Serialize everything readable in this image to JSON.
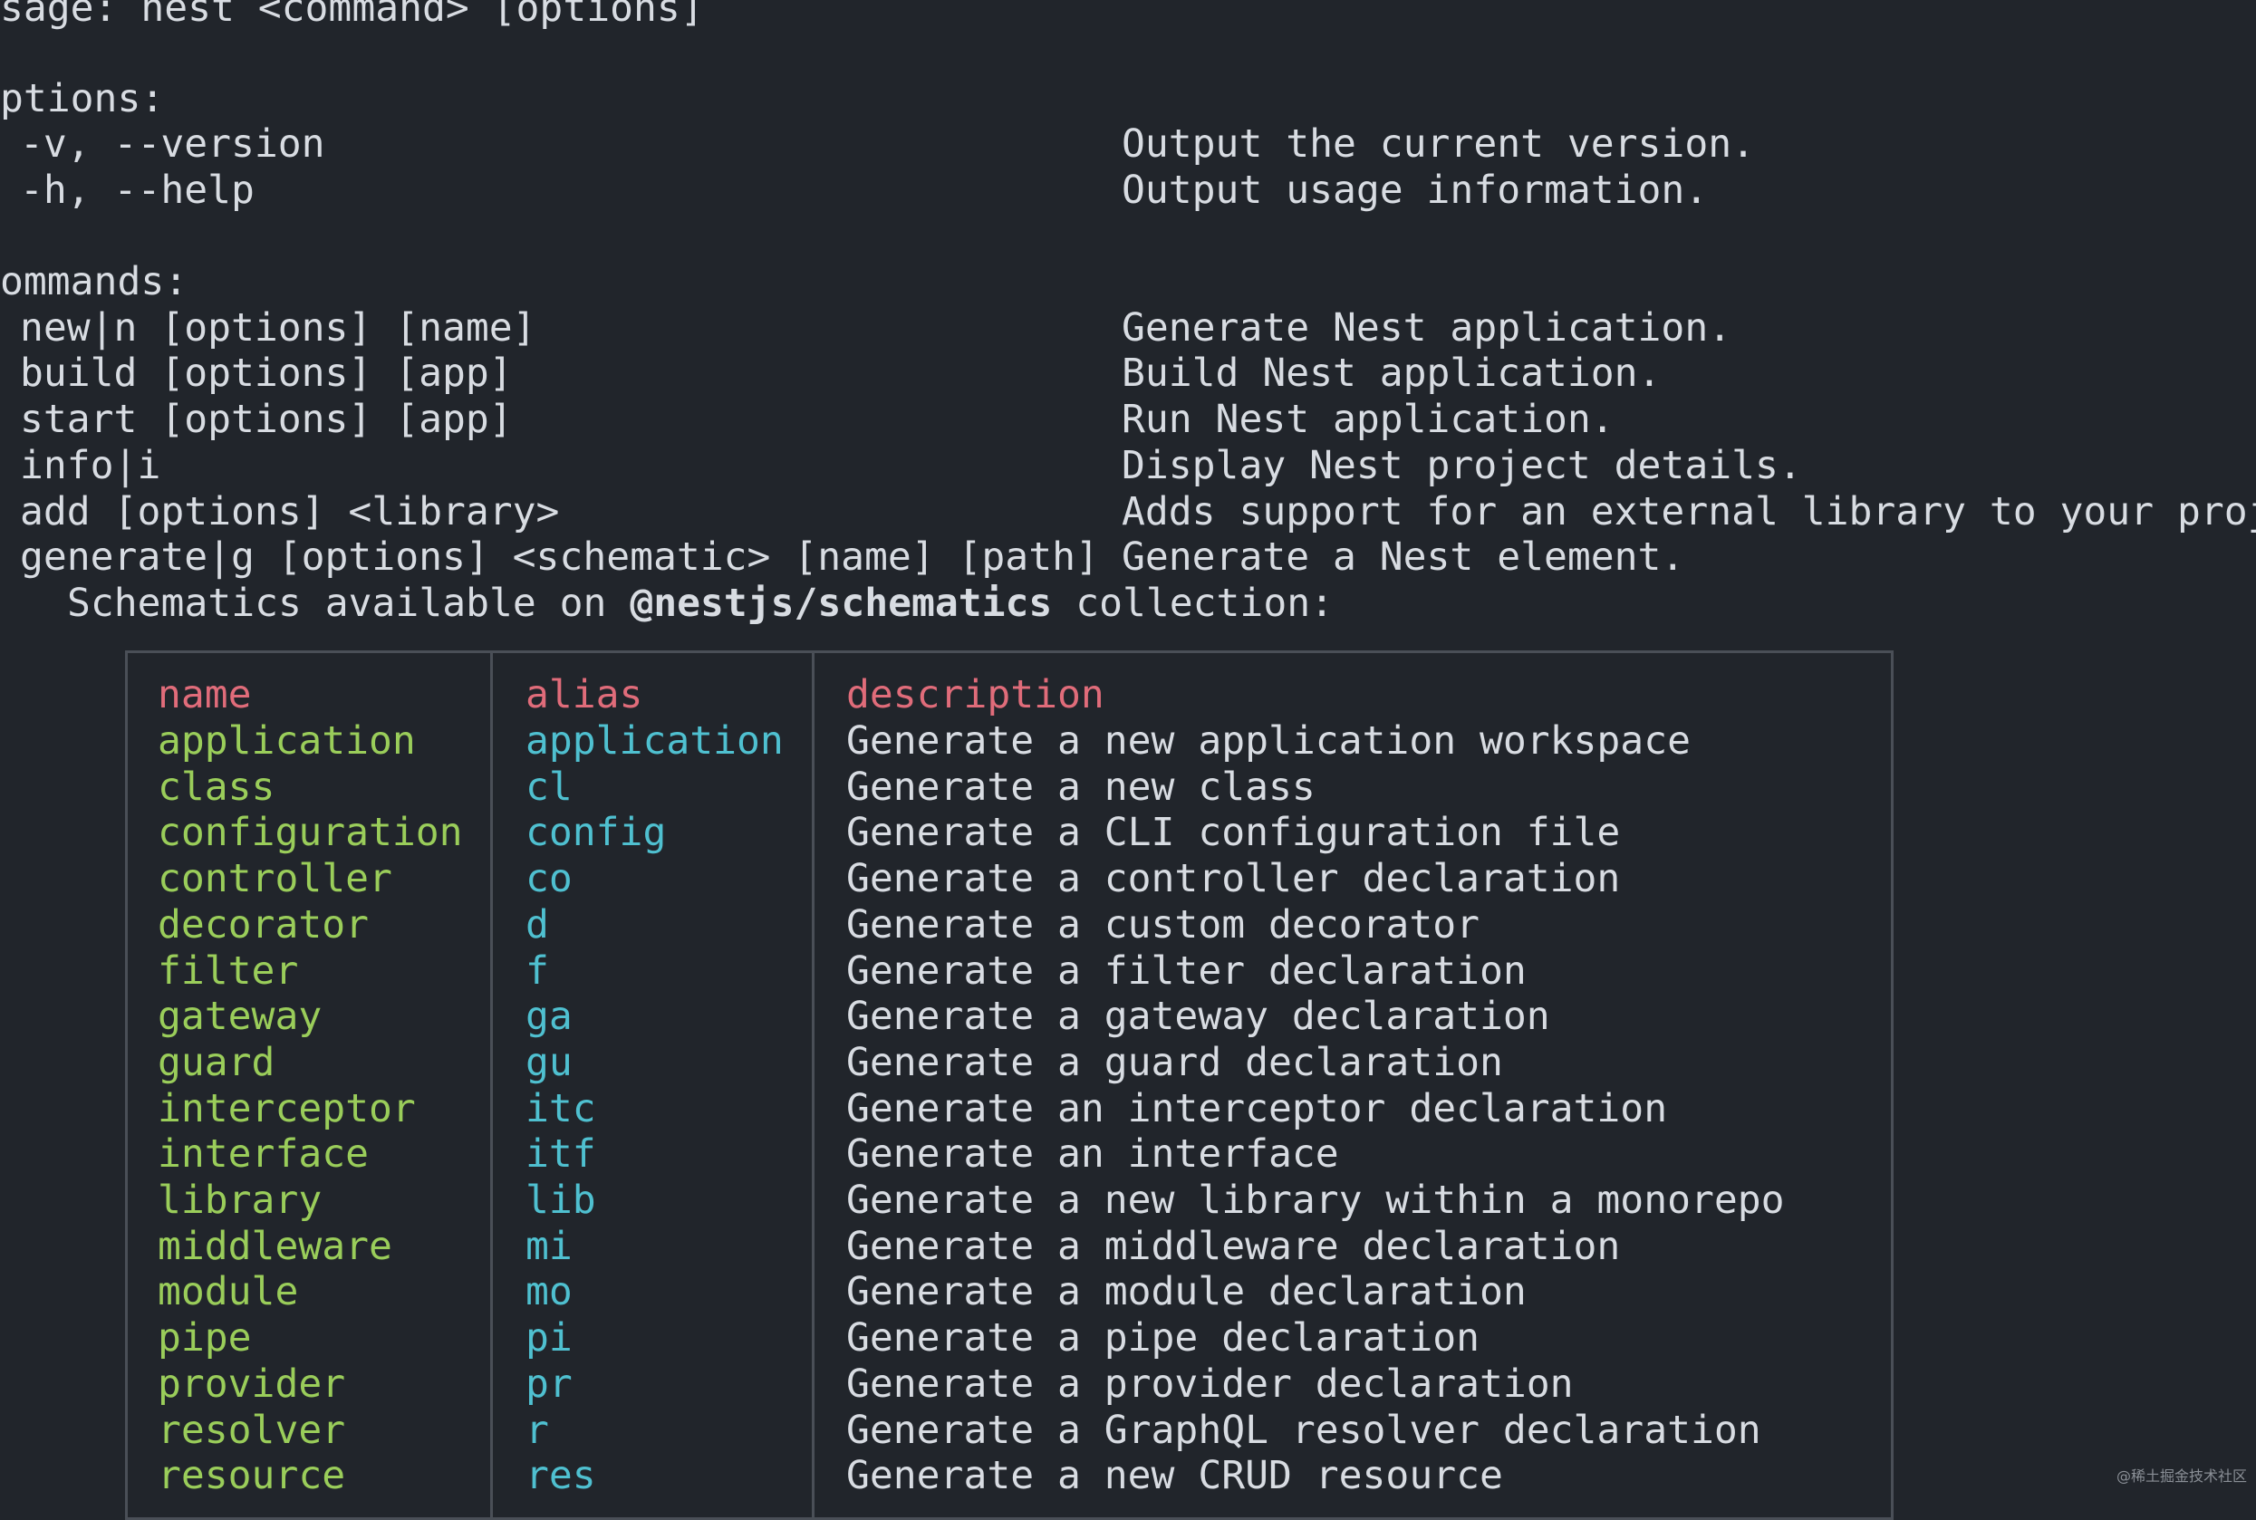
{
  "terminal": {
    "usage": "sage: nest <command> [options]",
    "options_header": "ptions:",
    "options": [
      {
        "flag": "-v, --version",
        "desc": "Output the current version."
      },
      {
        "flag": "-h, --help",
        "desc": "Output usage information."
      }
    ],
    "commands_header": "ommands:",
    "commands": [
      {
        "cmd": "new|n [options] [name]",
        "desc": "Generate Nest application."
      },
      {
        "cmd": "build [options] [app]",
        "desc": "Build Nest application."
      },
      {
        "cmd": "start [options] [app]",
        "desc": "Run Nest application."
      },
      {
        "cmd": "info|i",
        "desc": "Display Nest project details."
      },
      {
        "cmd": "add [options] <library>",
        "desc": "Adds support for an external library to your proje"
      },
      {
        "cmd": "generate|g [options] <schematic> [name] [path]",
        "desc": "Generate a Nest element."
      }
    ],
    "schematics_prefix": "Schematics available on ",
    "schematics_collection": "@nestjs/schematics",
    "schematics_suffix": " collection:"
  },
  "table": {
    "headers": {
      "name": "name",
      "alias": "alias",
      "description": "description"
    },
    "rows": [
      {
        "name": "application",
        "alias": "application",
        "description": "Generate a new application workspace"
      },
      {
        "name": "class",
        "alias": "cl",
        "description": "Generate a new class"
      },
      {
        "name": "configuration",
        "alias": "config",
        "description": "Generate a CLI configuration file"
      },
      {
        "name": "controller",
        "alias": "co",
        "description": "Generate a controller declaration"
      },
      {
        "name": "decorator",
        "alias": "d",
        "description": "Generate a custom decorator"
      },
      {
        "name": "filter",
        "alias": "f",
        "description": "Generate a filter declaration"
      },
      {
        "name": "gateway",
        "alias": "ga",
        "description": "Generate a gateway declaration"
      },
      {
        "name": "guard",
        "alias": "gu",
        "description": "Generate a guard declaration"
      },
      {
        "name": "interceptor",
        "alias": "itc",
        "description": "Generate an interceptor declaration"
      },
      {
        "name": "interface",
        "alias": "itf",
        "description": "Generate an interface"
      },
      {
        "name": "library",
        "alias": "lib",
        "description": "Generate a new library within a monorepo"
      },
      {
        "name": "middleware",
        "alias": "mi",
        "description": "Generate a middleware declaration"
      },
      {
        "name": "module",
        "alias": "mo",
        "description": "Generate a module declaration"
      },
      {
        "name": "pipe",
        "alias": "pi",
        "description": "Generate a pipe declaration"
      },
      {
        "name": "provider",
        "alias": "pr",
        "description": "Generate a provider declaration"
      },
      {
        "name": "resolver",
        "alias": "r",
        "description": "Generate a GraphQL resolver declaration"
      },
      {
        "name": "resource",
        "alias": "res",
        "description": "Generate a new CRUD resource"
      }
    ]
  },
  "colors": {
    "background": "#21252b",
    "text": "#d8dce2",
    "header": "#e06c7a",
    "name": "#9acd5a",
    "alias": "#4fc0d0",
    "border": "#4a4f57"
  },
  "watermark": "@稀土掘金技术社区"
}
